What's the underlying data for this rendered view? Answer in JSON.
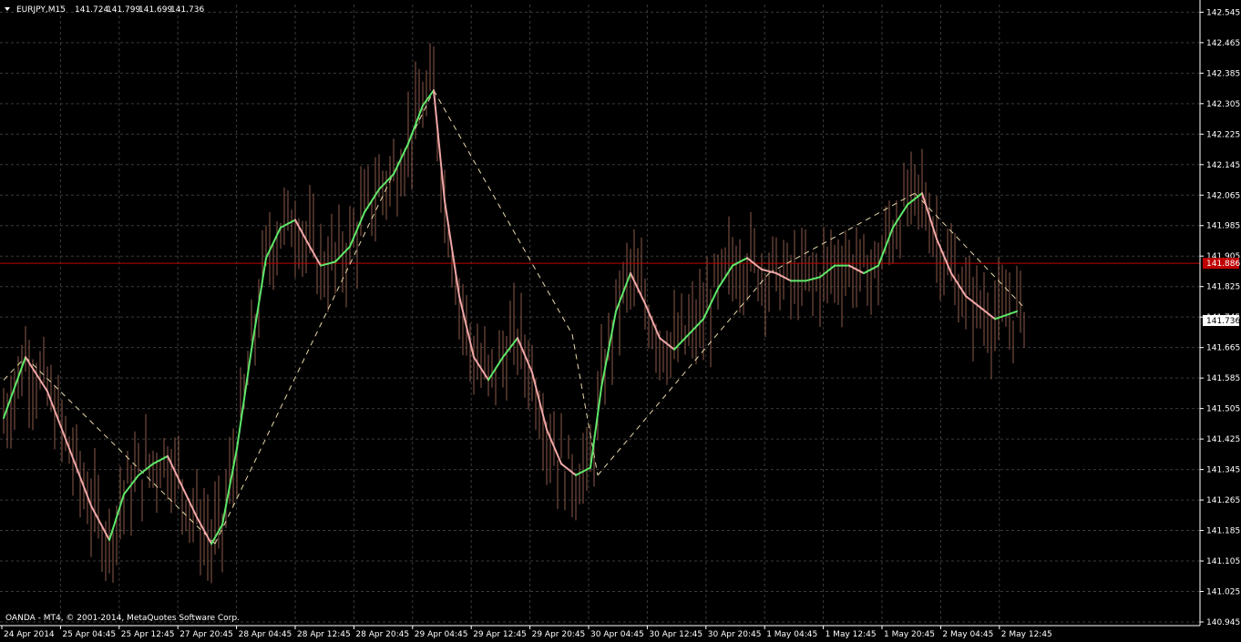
{
  "header": {
    "symbol": "EURJPY,M15",
    "open": "141.724",
    "high": "141.799",
    "low": "141.699",
    "close": "141.736"
  },
  "watermark": "OANDA - MT4, © 2001-2014, MetaQuotes Software Corp.",
  "colors": {
    "background": "#000000",
    "grid": "#3a3a3a",
    "candle": "#8b5a4a",
    "ma_up": "#5ee86a",
    "ma_down": "#f1a7a7",
    "zigzag": "#e8d8a8",
    "hline": "#c00000",
    "text": "#ffffff"
  },
  "chart_data": {
    "type": "line",
    "title": "EURJPY,M15",
    "xlabel": "",
    "ylabel": "",
    "grid": true,
    "ylim": [
      140.945,
      142.565
    ],
    "y_ticks": [
      "142.545",
      "142.465",
      "142.385",
      "142.305",
      "142.225",
      "142.145",
      "142.065",
      "141.985",
      "141.905",
      "141.825",
      "141.745",
      "141.665",
      "141.585",
      "141.505",
      "141.425",
      "141.345",
      "141.265",
      "141.185",
      "141.105",
      "141.025",
      "140.945"
    ],
    "x_ticks": [
      "24 Apr 2014",
      "25 Apr 04:45",
      "25 Apr 12:45",
      "27 Apr 20:45",
      "28 Apr 04:45",
      "28 Apr 12:45",
      "28 Apr 20:45",
      "29 Apr 04:45",
      "29 Apr 12:45",
      "29 Apr 20:45",
      "30 Apr 04:45",
      "30 Apr 12:45",
      "30 Apr 20:45",
      "1 May 04:45",
      "1 May 12:45",
      "1 May 20:45",
      "2 May 04:45",
      "2 May 12:45"
    ],
    "horizontal_line": {
      "value": 141.886,
      "label": "141.886"
    },
    "current_price": {
      "value": 141.736,
      "label": "141.736"
    },
    "series": [
      {
        "style": "zigzag",
        "points": [
          {
            "bar": 0,
            "price": 141.58
          },
          {
            "bar": 6,
            "price": 141.64
          },
          {
            "bar": 58,
            "price": 141.15
          },
          {
            "bar": 118,
            "price": 142.34
          },
          {
            "bar": 156,
            "price": 141.7
          },
          {
            "bar": 163,
            "price": 141.33
          },
          {
            "bar": 210,
            "price": 141.86
          },
          {
            "bar": 250,
            "price": 142.07
          },
          {
            "bar": 280,
            "price": 141.77
          }
        ]
      },
      {
        "style": "moving-average",
        "points": [
          [
            0,
            141.48
          ],
          [
            6,
            141.64
          ],
          [
            12,
            141.55
          ],
          [
            18,
            141.4
          ],
          [
            24,
            141.25
          ],
          [
            29,
            141.16
          ],
          [
            33,
            141.28
          ],
          [
            37,
            141.33
          ],
          [
            41,
            141.36
          ],
          [
            45,
            141.38
          ],
          [
            49,
            141.3
          ],
          [
            53,
            141.22
          ],
          [
            57,
            141.15
          ],
          [
            60,
            141.2
          ],
          [
            64,
            141.4
          ],
          [
            68,
            141.66
          ],
          [
            72,
            141.9
          ],
          [
            76,
            141.98
          ],
          [
            80,
            142.0
          ],
          [
            84,
            141.93
          ],
          [
            87,
            141.88
          ],
          [
            91,
            141.89
          ],
          [
            95,
            141.93
          ],
          [
            99,
            142.02
          ],
          [
            103,
            142.08
          ],
          [
            107,
            142.12
          ],
          [
            111,
            142.2
          ],
          [
            115,
            142.3
          ],
          [
            118,
            142.34
          ],
          [
            121,
            142.05
          ],
          [
            125,
            141.8
          ],
          [
            129,
            141.64
          ],
          [
            133,
            141.58
          ],
          [
            137,
            141.64
          ],
          [
            141,
            141.69
          ],
          [
            145,
            141.6
          ],
          [
            149,
            141.45
          ],
          [
            153,
            141.36
          ],
          [
            157,
            141.33
          ],
          [
            161,
            141.35
          ],
          [
            164,
            141.56
          ],
          [
            168,
            141.76
          ],
          [
            172,
            141.86
          ],
          [
            176,
            141.78
          ],
          [
            180,
            141.69
          ],
          [
            184,
            141.66
          ],
          [
            188,
            141.7
          ],
          [
            192,
            141.74
          ],
          [
            196,
            141.82
          ],
          [
            200,
            141.88
          ],
          [
            204,
            141.9
          ],
          [
            208,
            141.87
          ],
          [
            212,
            141.86
          ],
          [
            216,
            141.84
          ],
          [
            220,
            141.84
          ],
          [
            224,
            141.85
          ],
          [
            228,
            141.88
          ],
          [
            232,
            141.88
          ],
          [
            236,
            141.86
          ],
          [
            240,
            141.88
          ],
          [
            244,
            141.98
          ],
          [
            248,
            142.04
          ],
          [
            252,
            142.07
          ],
          [
            256,
            141.95
          ],
          [
            260,
            141.86
          ],
          [
            264,
            141.8
          ],
          [
            268,
            141.77
          ],
          [
            272,
            141.74
          ],
          [
            278,
            141.76
          ]
        ]
      }
    ]
  }
}
